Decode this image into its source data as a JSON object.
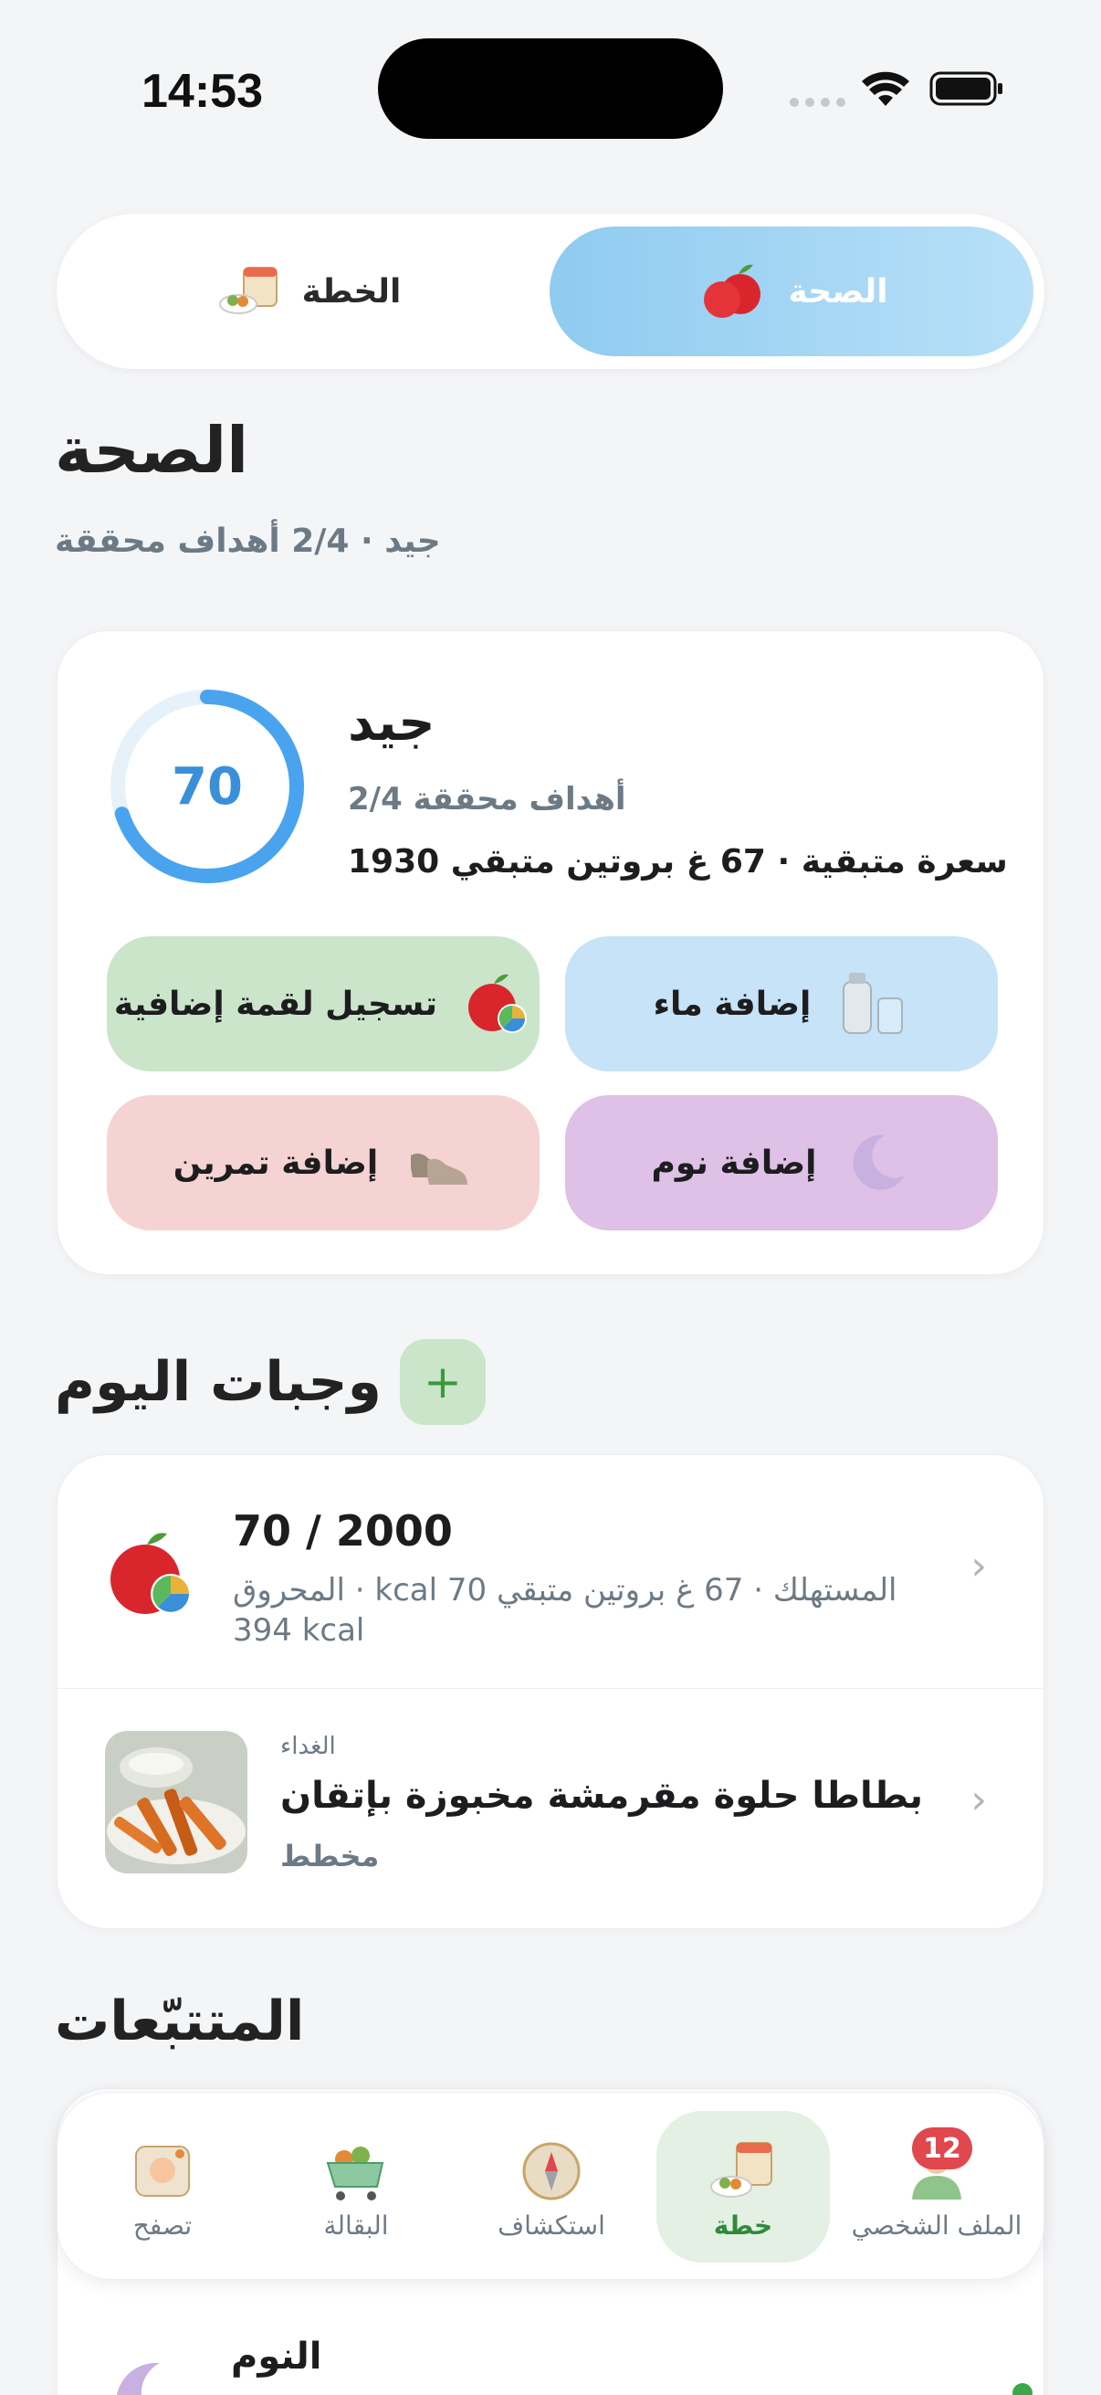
{
  "status_bar": {
    "time": "14:53"
  },
  "segment": {
    "health_label": "الصحة",
    "plan_label": "الخطة"
  },
  "health": {
    "title": "الصحة",
    "subtitle": "جيد · 2/4 أهداف محققة",
    "score": "70",
    "score_progress": 0.7,
    "score_label": "جيد",
    "goals_text": "أهداف محققة 2/4",
    "remaining_text": "سعرة متبقية · 67 غ بروتين متبقي 1930"
  },
  "quick_actions": {
    "water": "إضافة ماء",
    "meal": "تسجيل لقمة إضافية",
    "sleep": "إضافة نوم",
    "exercise": "إضافة تمرين"
  },
  "meals": {
    "title": "وجبات اليوم",
    "summary_main": "70 / 2000",
    "summary_sub": "المحروق · kcal 70 ‏المستهلك · 67 غ بروتين متبقي 394 kcal",
    "items": [
      {
        "type": "الغداء",
        "name": "بطاطا حلوة مقرمشة مخبوزة بإتقان",
        "status": "مخطط"
      }
    ]
  },
  "trackers": {
    "title": "المتتبّعات",
    "sleep_label": "النوم"
  },
  "tabbar": {
    "profile": "الملف الشخصي",
    "profile_badge": "12",
    "plan": "خطة",
    "explore": "استكشاف",
    "grocery": "البقالة",
    "browse": "تصفح"
  },
  "colors": {
    "accent_blue": "#3a8fd8",
    "active_green": "#2f8a3a",
    "badge_red": "#e0484e"
  }
}
